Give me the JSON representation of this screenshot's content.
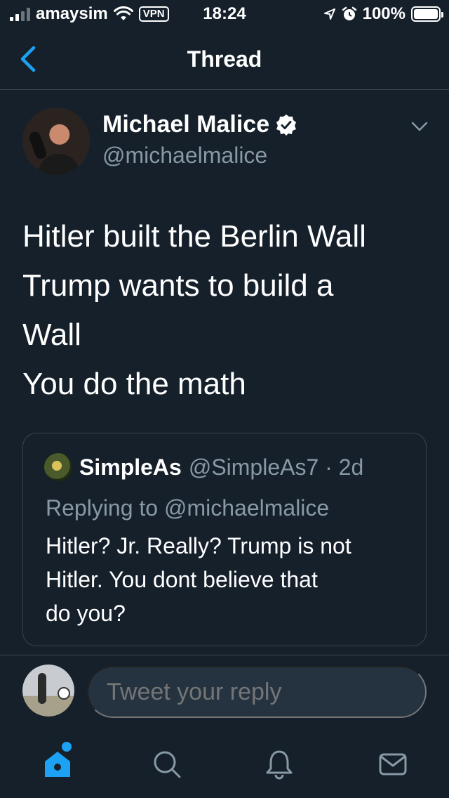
{
  "status_bar": {
    "carrier": "amaysim",
    "vpn": "VPN",
    "time": "18:24",
    "battery": "100%",
    "battery_level": 1.0
  },
  "nav": {
    "title": "Thread"
  },
  "tweet": {
    "author_name": "Michael Malice",
    "author_handle": "@michaelmalice",
    "lines": [
      "Hitler built the Berlin Wall",
      "Trump wants to build a",
      "Wall",
      "You do the math"
    ]
  },
  "quoted_tweet": {
    "name": "SimpleAs",
    "meta": "@SimpleAs7 · 2d",
    "replying_prefix": "Replying to",
    "replying_to": "@michaelmalice",
    "lines": [
      "Hitler? Jr. Really? Trump is not",
      "Hitler. You dont believe that",
      "do you?"
    ]
  },
  "reply_bar": {
    "placeholder": "Tweet your reply"
  },
  "colors": {
    "background": "#15202b",
    "accent": "#1da1f2",
    "secondary_text": "#8899a6",
    "border": "#38444d"
  },
  "icons": {
    "back": "chevron-left-icon",
    "verified": "verified-badge-icon",
    "caret": "chevron-down-icon",
    "home": "home-icon",
    "search": "search-icon",
    "notifications": "bell-icon",
    "messages": "envelope-icon"
  }
}
